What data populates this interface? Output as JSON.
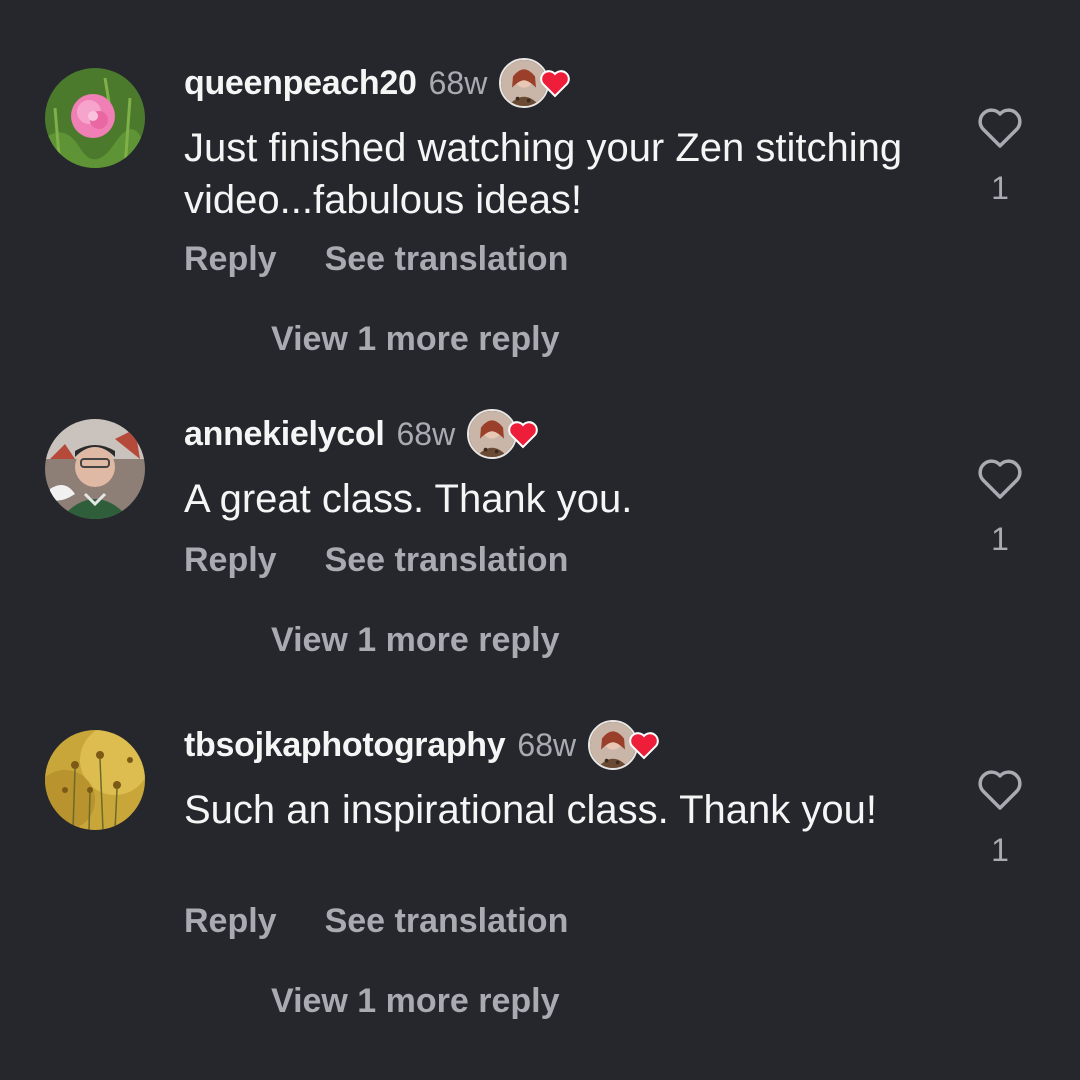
{
  "comments": [
    {
      "username": "queenpeach20",
      "time": "68w",
      "text": "Just finished watching your Zen stitching video...fabulous ideas!",
      "reply_label": "Reply",
      "translate_label": "See translation",
      "view_more_label": "View 1 more reply",
      "like_count": "1"
    },
    {
      "username": "annekielycol",
      "time": "68w",
      "text": "A great class. Thank you.",
      "reply_label": "Reply",
      "translate_label": "See translation",
      "view_more_label": "View 1 more reply",
      "like_count": "1"
    },
    {
      "username": "tbsojkaphotography",
      "time": "68w",
      "text": "Such an inspirational class. Thank you!",
      "reply_label": "Reply",
      "translate_label": "See translation",
      "view_more_label": "View 1 more reply",
      "like_count": "1"
    }
  ],
  "icons": {
    "like": "heart-outline-icon",
    "author_liked": "heart-filled-icon"
  },
  "colors": {
    "background": "#25272c",
    "text_primary": "#f5f5f5",
    "text_secondary": "#a8abb2",
    "author_heart": "#ee1d3a"
  }
}
